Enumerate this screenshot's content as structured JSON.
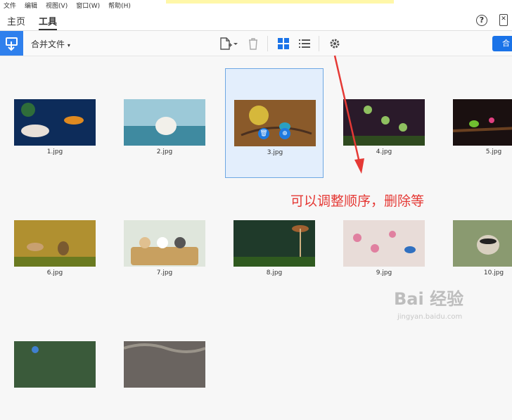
{
  "menubar": {
    "items": [
      "文件",
      "编辑",
      "视图(V)",
      "窗口(W)",
      "帮助(H)"
    ]
  },
  "tabs": [
    {
      "label": "主页"
    },
    {
      "label": "工具"
    }
  ],
  "toolbar": {
    "merge_label": "合并文件",
    "primary_label": "合"
  },
  "thumbnails": [
    {
      "label": "1.jpg"
    },
    {
      "label": "2.jpg"
    },
    {
      "label": "3.jpg"
    },
    {
      "label": "4.jpg"
    },
    {
      "label": "5.jpg"
    },
    {
      "label": "6.jpg"
    },
    {
      "label": "7.jpg"
    },
    {
      "label": "8.jpg"
    },
    {
      "label": "9.jpg"
    },
    {
      "label": "10.jpg"
    }
  ],
  "annotation": "可以调整顺序，删除等",
  "watermark": {
    "brand": "Bai 经验",
    "url": "jingyan.baidu.com"
  },
  "colors": {
    "accent": "#1a73e8",
    "selection_bg": "#e3eefc",
    "annotation": "#e53935"
  }
}
